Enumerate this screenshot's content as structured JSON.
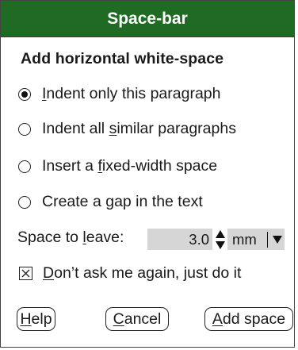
{
  "dialog": {
    "title": "Space-bar",
    "heading": "Add horizontal white-space",
    "options": [
      {
        "pre": "",
        "key": "I",
        "post": "ndent only this paragraph",
        "selected": true
      },
      {
        "pre": "Indent all ",
        "key": "s",
        "post": "imilar paragraphs",
        "selected": false
      },
      {
        "pre": "Insert a ",
        "key": "f",
        "post": "ixed-width space",
        "selected": false
      },
      {
        "pre": "Create a ",
        "key": "g",
        "post": "ap in the text",
        "selected": false
      }
    ],
    "space": {
      "label_pre": "Space to ",
      "label_key": "l",
      "label_post": "eave:",
      "value": "3.0",
      "unit": "mm"
    },
    "dont_ask": {
      "key": "D",
      "post": "on’t ask me again, just do it",
      "checked": true
    },
    "buttons": {
      "help_key": "H",
      "help_post": "elp",
      "cancel_key": "C",
      "cancel_post": "ancel",
      "add_key": "A",
      "add_post": "dd space"
    }
  },
  "colors": {
    "titlebar": "#1f6b24",
    "field": "#d6d6d6"
  }
}
